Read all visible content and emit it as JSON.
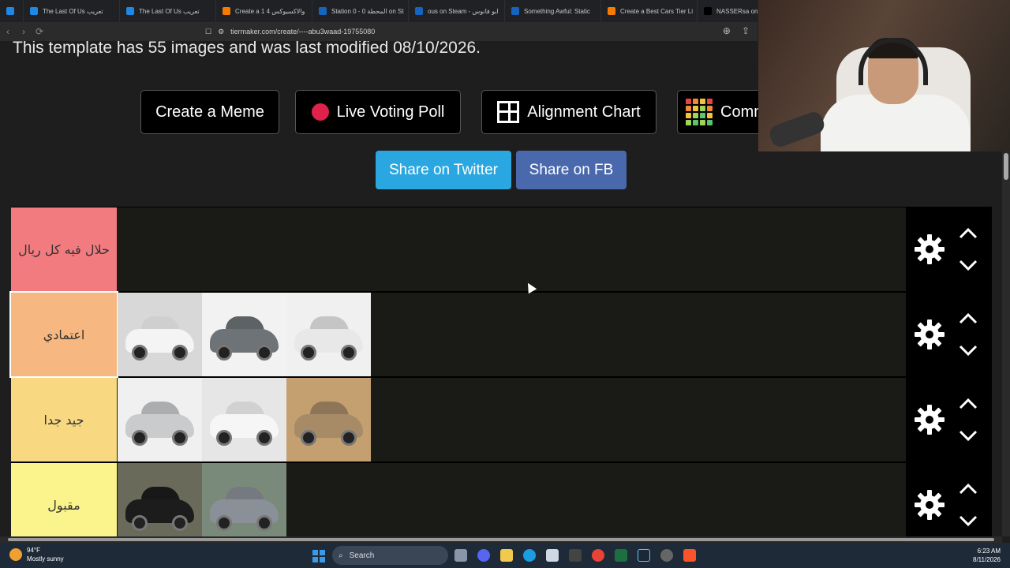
{
  "browser": {
    "tabs": [
      {
        "label": "",
        "color": "#1e88e5"
      },
      {
        "label": "The Last Of Us تعريب",
        "color": "#1e88e5"
      },
      {
        "label": "The Last Of Us تعريب",
        "color": "#1e88e5"
      },
      {
        "label": "Create a 1 والاكسيوكس 4",
        "color": "#f57c00"
      },
      {
        "label": "Station 0 - 0 المحطة on St",
        "color": "#1565c0"
      },
      {
        "label": "ous on Steam - ابو فانوس",
        "color": "#1565c0"
      },
      {
        "label": "Something Awful: Static",
        "color": "#1565c0"
      },
      {
        "label": "Create a Best Cars Tier Li",
        "color": "#f57c00"
      },
      {
        "label": "NASSERsa on X: \"@",
        "color": "#000000"
      }
    ],
    "url": "tiermaker.com/create/----abu3waad-19755080"
  },
  "page": {
    "subtitle": "This template has 55 images and was last modified 08/10/2026.",
    "buttons": {
      "meme": "Create a Meme",
      "poll": "Live Voting Poll",
      "alignment": "Alignment Chart",
      "community": "Comm"
    },
    "share": {
      "twitter": "Share on Twitter",
      "facebook": "Share on FB",
      "twitter_color": "#2aa7e0",
      "facebook_color": "#4a69ad"
    }
  },
  "tiers": [
    {
      "label": "حلال فيه كل ريال",
      "color": "#f27b80",
      "cars": []
    },
    {
      "label": "اعتمادي",
      "color": "#f6b880",
      "cars": [
        "white-pickup",
        "grey-sedan",
        "white-suv"
      ]
    },
    {
      "label": "جيد جدا",
      "color": "#f8d880",
      "cars": [
        "silver-sedan",
        "white-sedan",
        "bronze-suv"
      ]
    },
    {
      "label": "مقبول",
      "color": "#fbf38c",
      "cars": [
        "black-sedan",
        "grey-suv"
      ]
    }
  ],
  "car_colors": {
    "white-pickup": {
      "bg": "#d8d8d8",
      "body": "#f4f4f4"
    },
    "grey-sedan": {
      "bg": "#f2f2f2",
      "body": "#6d7377"
    },
    "white-suv": {
      "bg": "#f0f0f0",
      "body": "#e8e8e8"
    },
    "silver-sedan": {
      "bg": "#f0f0f0",
      "body": "#c9cbcd"
    },
    "white-sedan": {
      "bg": "#e6e6e6",
      "body": "#f6f6f6"
    },
    "bronze-suv": {
      "bg": "#c4a070",
      "body": "#a78a66"
    },
    "black-sedan": {
      "bg": "#6a6a5a",
      "body": "#1c1c1c"
    },
    "grey-suv": {
      "bg": "#7a8a7a",
      "body": "#8a9097"
    }
  },
  "taskbar": {
    "temperature": "94°F",
    "weather": "Mostly sunny",
    "search": "Search",
    "time": "6:23 AM",
    "date": "8/11/2026"
  }
}
